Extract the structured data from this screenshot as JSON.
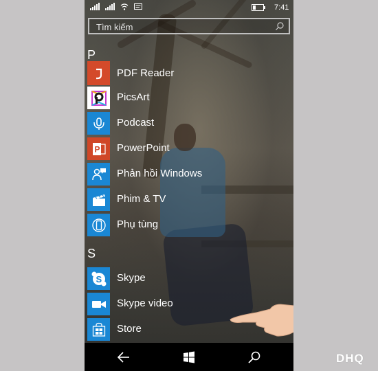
{
  "status": {
    "time": "7:41",
    "battery_level": 0.3
  },
  "search": {
    "placeholder": "Tìm kiếm",
    "icon": "search-icon"
  },
  "sections": [
    {
      "letter": "P"
    },
    {
      "letter": "S"
    }
  ],
  "apps": [
    {
      "label": "PDF Reader",
      "icon": "pdf-reader-icon",
      "color": "#d44a2a"
    },
    {
      "label": "PicsArt",
      "icon": "picsart-icon",
      "color": "#ffffff"
    },
    {
      "label": "Podcast",
      "icon": "podcast-icon",
      "color": "#1a87d4"
    },
    {
      "label": "PowerPoint",
      "icon": "powerpoint-icon",
      "color": "#d04727"
    },
    {
      "label": "Phản hồi Windows",
      "icon": "feedback-icon",
      "color": "#1a87d4"
    },
    {
      "label": "Phim & TV",
      "icon": "movies-tv-icon",
      "color": "#1a87d4"
    },
    {
      "label": "Phụ tùng",
      "icon": "accessories-icon",
      "color": "#1a87d4"
    },
    {
      "label": "Skype",
      "icon": "skype-icon",
      "color": "#1a87d4"
    },
    {
      "label": "Skype video",
      "icon": "skype-video-icon",
      "color": "#1a87d4"
    },
    {
      "label": "Store",
      "icon": "store-icon",
      "color": "#1a87d4"
    }
  ],
  "nav": {
    "back": "back-arrow-icon",
    "home": "windows-logo-icon",
    "search": "search-icon"
  },
  "watermark": "DHQ"
}
